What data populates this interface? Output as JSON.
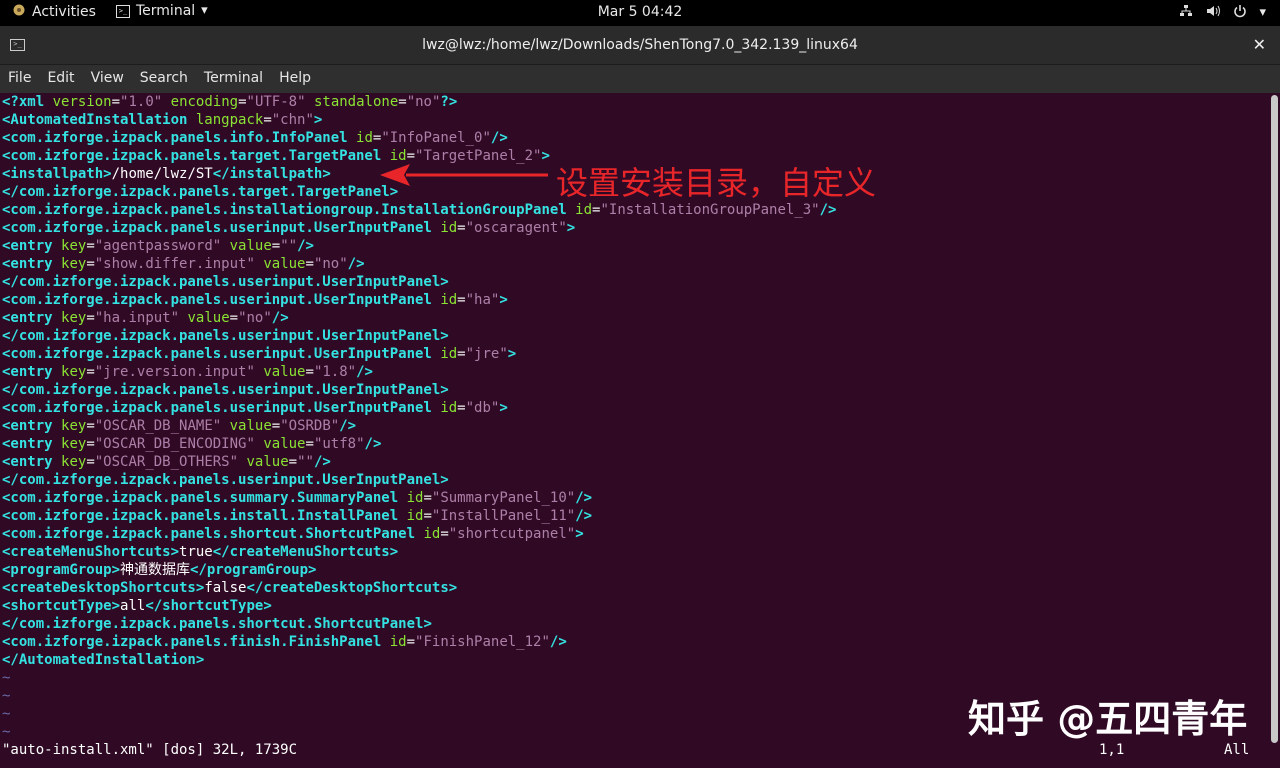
{
  "topbar": {
    "activities": "Activities",
    "app_menu": "Terminal",
    "clock": "Mar 5  04:42",
    "icons": [
      "network-icon",
      "volume-icon",
      "power-icon"
    ]
  },
  "window": {
    "title": "lwz@lwz:/home/lwz/Downloads/ShenTong7.0_342.139_linux64",
    "close": "✕"
  },
  "menu": [
    "File",
    "Edit",
    "View",
    "Search",
    "Terminal",
    "Help"
  ],
  "editor": {
    "lines": [
      "<?xml version=\"1.0\" encoding=\"UTF-8\" standalone=\"no\"?>",
      "<AutomatedInstallation langpack=\"chn\">",
      "<com.izforge.izpack.panels.info.InfoPanel id=\"InfoPanel_0\"/>",
      "<com.izforge.izpack.panels.target.TargetPanel id=\"TargetPanel_2\">",
      "<installpath>/home/lwz/ST</installpath>",
      "</com.izforge.izpack.panels.target.TargetPanel>",
      "<com.izforge.izpack.panels.installationgroup.InstallationGroupPanel id=\"InstallationGroupPanel_3\"/>",
      "<com.izforge.izpack.panels.userinput.UserInputPanel id=\"oscaragent\">",
      "<entry key=\"agentpassword\" value=\"\"/>",
      "<entry key=\"show.differ.input\" value=\"no\"/>",
      "</com.izforge.izpack.panels.userinput.UserInputPanel>",
      "<com.izforge.izpack.panels.userinput.UserInputPanel id=\"ha\">",
      "<entry key=\"ha.input\" value=\"no\"/>",
      "</com.izforge.izpack.panels.userinput.UserInputPanel>",
      "<com.izforge.izpack.panels.userinput.UserInputPanel id=\"jre\">",
      "<entry key=\"jre.version.input\" value=\"1.8\"/>",
      "</com.izforge.izpack.panels.userinput.UserInputPanel>",
      "<com.izforge.izpack.panels.userinput.UserInputPanel id=\"db\">",
      "<entry key=\"OSCAR_DB_NAME\" value=\"OSRDB\"/>",
      "<entry key=\"OSCAR_DB_ENCODING\" value=\"utf8\"/>",
      "<entry key=\"OSCAR_DB_OTHERS\" value=\"\"/>",
      "</com.izforge.izpack.panels.userinput.UserInputPanel>",
      "<com.izforge.izpack.panels.summary.SummaryPanel id=\"SummaryPanel_10\"/>",
      "<com.izforge.izpack.panels.install.InstallPanel id=\"InstallPanel_11\"/>",
      "<com.izforge.izpack.panels.shortcut.ShortcutPanel id=\"shortcutpanel\">",
      "<createMenuShortcuts>true</createMenuShortcuts>",
      "<programGroup>神通数据库</programGroup>",
      "<createDesktopShortcuts>false</createDesktopShortcuts>",
      "<shortcutType>all</shortcutType>",
      "</com.izforge.izpack.panels.shortcut.ShortcutPanel>",
      "<com.izforge.izpack.panels.finish.FinishPanel id=\"FinishPanel_12\"/>",
      "</AutomatedInstallation>"
    ],
    "tilde_lines": [
      "~",
      "~",
      "~",
      "~"
    ],
    "status_file": "\"auto-install.xml\" [dos] 32L, 1739C",
    "status_pos": "1,1",
    "status_all": "All"
  },
  "annotation": "设置安装目录，自定义",
  "watermark": "知乎 @五四青年",
  "colors": {
    "background": "#300a24",
    "tag": "#34e2e2",
    "attribute": "#8ae234",
    "value": "#ad7fa8",
    "annotation": "#e8262a"
  }
}
